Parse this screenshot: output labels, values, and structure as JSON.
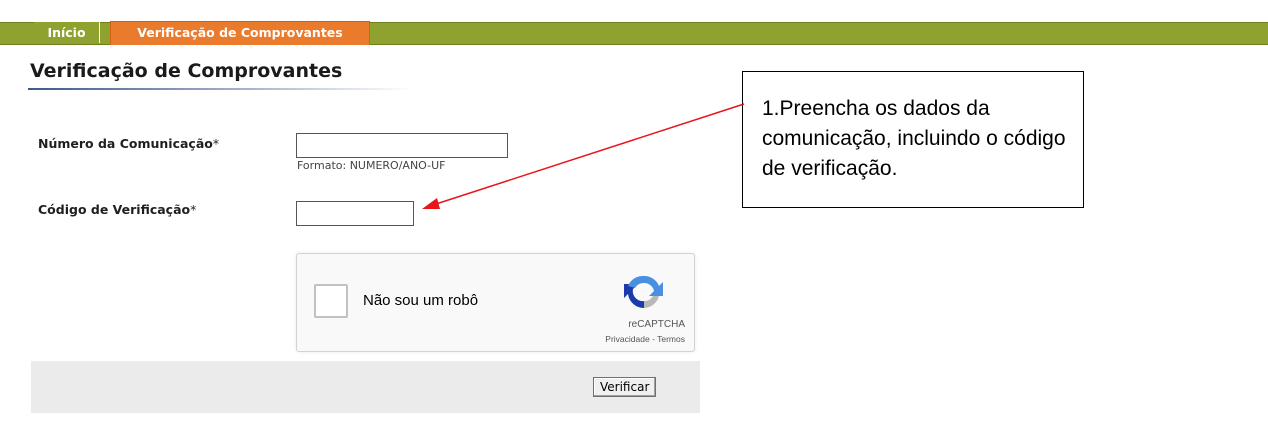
{
  "nav": {
    "tabs": [
      {
        "label": "Início"
      },
      {
        "label": "Verificação de Comprovantes"
      }
    ]
  },
  "page": {
    "title": "Verificação de Comprovantes"
  },
  "form": {
    "numero": {
      "label": "Número da Comunicação",
      "required_mark": "*",
      "value": "",
      "hint": "Formato: NUMERO/ANO-UF"
    },
    "codigo": {
      "label": "Código de Verificação",
      "required_mark": "*",
      "value": ""
    }
  },
  "captcha": {
    "label": "Não sou um robô",
    "brand": "reCAPTCHA",
    "privacy_link": "Privacidade",
    "separator": " - ",
    "terms_link": "Termos",
    "icon": "recaptcha-logo-icon"
  },
  "actions": {
    "verify_label": "Verificar"
  },
  "annotation": {
    "text": "1.Preencha os dados da comunicação, incluindo o código de verificação.",
    "arrow_color": "#e8151b"
  },
  "colors": {
    "nav_green": "#8fa12f",
    "active_tab_orange": "#ea7a2c"
  }
}
